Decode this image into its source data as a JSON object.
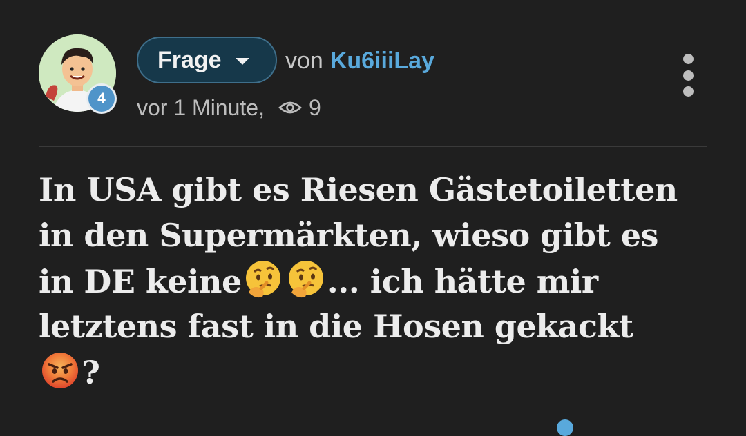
{
  "post": {
    "avatar": {
      "icon": "avatar-cartoon-man",
      "level": "4"
    },
    "type_label": "Frage",
    "by_word": "von",
    "username": "Ku6iiiLay",
    "timestamp": "vor 1 Minute,",
    "views": "9",
    "views_icon": "eye-icon",
    "menu_icon": "more-vertical-icon"
  },
  "question": {
    "line1": "In USA gibt es Riesen Gästetoiletten",
    "line2": "in den Supermärkten, wieso gibt es",
    "line3_start": "in DE keine",
    "line3_end": "... ich hätte mir",
    "line4": "letztens fast in die Hosen gekackt",
    "line5_end": "?",
    "emojis": [
      "thinking-face",
      "thinking-face",
      "angry-face"
    ]
  },
  "colors": {
    "background": "#1f1f1f",
    "pill_fill": "#16384a",
    "pill_border": "#3f6f8b",
    "username": "#59a9dc",
    "badge": "#4f94c9"
  }
}
